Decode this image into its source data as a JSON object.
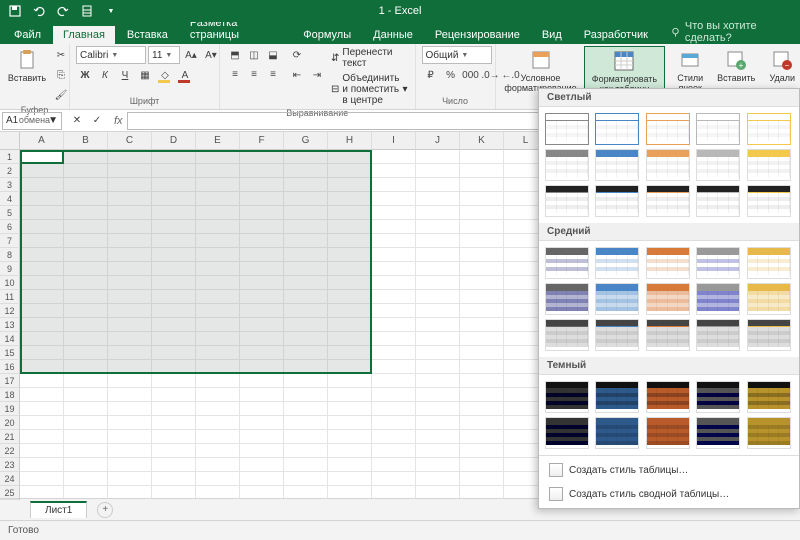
{
  "title": "1 - Excel",
  "qat": [
    "save",
    "undo",
    "redo",
    "touch",
    "more"
  ],
  "tabs": [
    "Файл",
    "Главная",
    "Вставка",
    "Разметка страницы",
    "Формулы",
    "Данные",
    "Рецензирование",
    "Вид",
    "Разработчик"
  ],
  "active_tab": 1,
  "tell_me": "Что вы хотите сделать?",
  "ribbon": {
    "clipboard": {
      "label": "Буфер обмена",
      "paste": "Вставить"
    },
    "font": {
      "label": "Шрифт",
      "name": "Calibri",
      "size": "11"
    },
    "alignment": {
      "label": "Выравнивание",
      "wrap": "Перенести текст",
      "merge": "Объединить и поместить в центре"
    },
    "number": {
      "label": "Число",
      "format": "Общий"
    },
    "styles": {
      "cond": "Условное форматирование",
      "table": "Форматировать как таблицу",
      "cell": "Стили ячеек"
    },
    "cells": {
      "insert": "Вставить",
      "delete": "Удали"
    }
  },
  "namebox": "A1",
  "columns": [
    "A",
    "B",
    "C",
    "D",
    "E",
    "F",
    "G",
    "H",
    "I",
    "J",
    "K",
    "L"
  ],
  "rows": [
    1,
    2,
    3,
    4,
    5,
    6,
    7,
    8,
    9,
    10,
    11,
    12,
    13,
    14,
    15,
    16,
    17,
    18,
    19,
    20,
    21,
    22,
    23,
    24,
    25
  ],
  "sheet": "Лист1",
  "status": "Готово",
  "gallery": {
    "sections": [
      "Светлый",
      "Средний",
      "Темный"
    ],
    "new_style": "Создать стиль таблицы…",
    "new_pivot": "Создать стиль сводной таблицы…"
  },
  "colors": {
    "light_accents": [
      "#888",
      "#4a86c5",
      "#e8a05a",
      "#b8b8b8",
      "#f2c94c",
      "#5aa8d6"
    ],
    "medium_accents": [
      "#666",
      "#4a86c5",
      "#d87b3a",
      "#999",
      "#e6b94a",
      "#4a9ed1"
    ],
    "dark_accents": [
      "#333",
      "#2d5a8a",
      "#b85a2a",
      "#555",
      "#b8922a",
      "#2d6a8a"
    ]
  }
}
